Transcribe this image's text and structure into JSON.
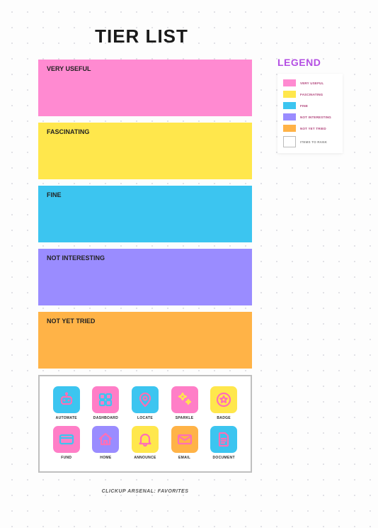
{
  "title": "TIER LIST",
  "tiers": [
    {
      "label": "VERY USEFUL"
    },
    {
      "label": "FASCINATING"
    },
    {
      "label": "FINE"
    },
    {
      "label": "NOT INTERESTING"
    },
    {
      "label": "NOT YET TRIED"
    }
  ],
  "legend": {
    "title": "LEGEND",
    "rows": [
      {
        "label": "VERY USEFUL"
      },
      {
        "label": "FASCINATING"
      },
      {
        "label": "FINE"
      },
      {
        "label": "NOT INTERESTING"
      },
      {
        "label": "NOT YET TRIED"
      },
      {
        "label": "ITEMS TO RANK"
      }
    ]
  },
  "pool": {
    "caption": "CLICKUP ARSENAL: FAVORITES",
    "items": [
      {
        "name": "AUTOMATE",
        "icon": "robot",
        "bg": "blue",
        "stroke": "#ff6fb5"
      },
      {
        "name": "DASHBOARD",
        "icon": "grid",
        "bg": "pink",
        "stroke": "#3cc5f0"
      },
      {
        "name": "LOCATE",
        "icon": "pin",
        "bg": "blue",
        "stroke": "#ff6fb5"
      },
      {
        "name": "SPARKLE",
        "icon": "sparkle",
        "bg": "pink",
        "stroke": "#ffe74c"
      },
      {
        "name": "BADGE",
        "icon": "star",
        "bg": "yellow",
        "stroke": "#ff6fb5"
      },
      {
        "name": "FUND",
        "icon": "card",
        "bg": "pink",
        "stroke": "#3cc5f0"
      },
      {
        "name": "HOME",
        "icon": "home",
        "bg": "purple",
        "stroke": "#ff6fb5"
      },
      {
        "name": "ANNOUNCE",
        "icon": "bell",
        "bg": "yellow",
        "stroke": "#ff6fb5"
      },
      {
        "name": "EMAIL",
        "icon": "mail",
        "bg": "orange",
        "stroke": "#ff6fb5"
      },
      {
        "name": "DOCUMENT",
        "icon": "doc",
        "bg": "blue",
        "stroke": "#ff6fb5"
      }
    ]
  }
}
